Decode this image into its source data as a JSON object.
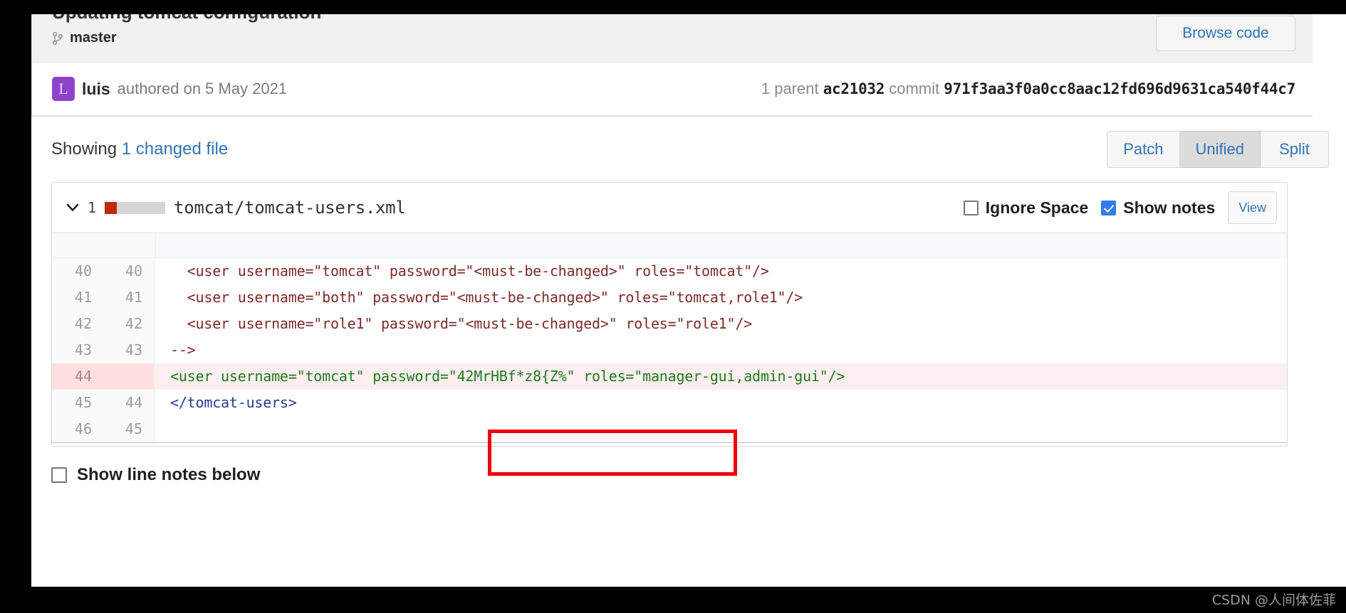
{
  "commit": {
    "title": "Updating tomcat configuration",
    "branch_icon": "branch-icon",
    "branch": "master",
    "browse_code_label": "Browse code",
    "avatar_letter": "L",
    "author": "luis",
    "authored_on": "authored on 5 May 2021",
    "parent_prefix": "1 parent",
    "parent_sha": "ac21032",
    "commit_word": "commit",
    "commit_sha": "971f3aa3f0a0cc8aac12fd696d9631ca540f44c7"
  },
  "showing": {
    "prefix": "Showing",
    "link": "1 changed file",
    "views": [
      {
        "label": "Patch",
        "active": false
      },
      {
        "label": "Unified",
        "active": true
      },
      {
        "label": "Split",
        "active": false
      }
    ]
  },
  "file": {
    "chevron": "⌄",
    "change_count": "1",
    "filename": "tomcat/tomcat-users.xml",
    "ignore_space_label": "Ignore Space",
    "ignore_space_checked": false,
    "show_notes_label": "Show notes",
    "show_notes_checked": true,
    "view_label": "View"
  },
  "diff": {
    "lines": [
      {
        "old": "40",
        "new": "40",
        "code": "  <user username=\"tomcat\" password=\"<must-be-changed>\" roles=\"tomcat\"/>",
        "state": "context"
      },
      {
        "old": "41",
        "new": "41",
        "code": "  <user username=\"both\" password=\"<must-be-changed>\" roles=\"tomcat,role1\"/>",
        "state": "context"
      },
      {
        "old": "42",
        "new": "42",
        "code": "  <user username=\"role1\" password=\"<must-be-changed>\" roles=\"role1\"/>",
        "state": "context"
      },
      {
        "old": "43",
        "new": "43",
        "code": "-->",
        "state": "context"
      },
      {
        "old": "44",
        "new": "",
        "code": "<user username=\"tomcat\" password=\"42MrHBf*z8{Z%\" roles=\"manager-gui,admin-gui\"/>",
        "state": "removed"
      },
      {
        "old": "45",
        "new": "44",
        "code": "</tomcat-users>",
        "state": "blue"
      },
      {
        "old": "46",
        "new": "45",
        "code": "",
        "state": "context"
      }
    ]
  },
  "footer": {
    "show_line_notes_label": "Show line notes below",
    "show_line_notes_checked": false
  },
  "watermark": "CSDN @人间体佐菲",
  "colors": {
    "accent_link": "#3273b7",
    "removed_bg": "#fdeef0",
    "removed_gutter": "#ffdfe0",
    "stat_delete": "#bd2c00",
    "checkbox_checked": "#2f7ded",
    "annotation": "#ee0000",
    "avatar": "#8e44c8"
  }
}
